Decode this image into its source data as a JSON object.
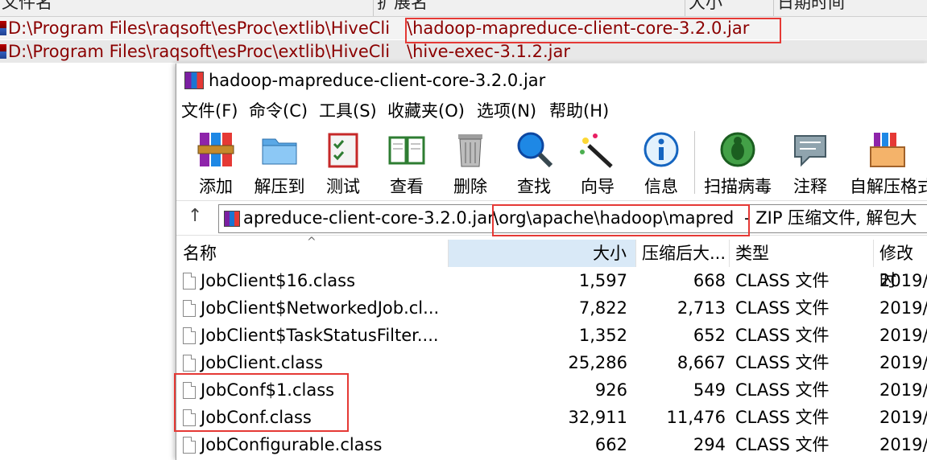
{
  "background_list": {
    "headers": [
      "文件名",
      "扩展名",
      "大小",
      "日期时间"
    ],
    "rows": [
      {
        "path": "D:\\Program Files\\raqsoft\\esProc\\extlib\\HiveCli",
        "ext": "\\hadoop-mapreduce-client-core-3.2.0.jar"
      },
      {
        "path": "D:\\Program Files\\raqsoft\\esProc\\extlib\\HiveCli",
        "ext": "\\hive-exec-3.1.2.jar"
      }
    ]
  },
  "window": {
    "title": "hadoop-mapreduce-client-core-3.2.0.jar",
    "menu": [
      "文件(F)",
      "命令(C)",
      "工具(S)",
      "收藏夹(O)",
      "选项(N)",
      "帮助(H)"
    ],
    "toolbar": [
      "添加",
      "解压到",
      "测试",
      "查看",
      "删除",
      "查找",
      "向导",
      "信息",
      "扫描病毒",
      "注释",
      "自解压格式"
    ],
    "address": {
      "part1": "apreduce-client-core-3.2.0.jar",
      "part2": "\\org\\apache\\hadoop\\mapred",
      "part3": "- ZIP 压缩文件, 解包大"
    },
    "columns": {
      "name": "名称",
      "size": "大小",
      "packed": "压缩后大...",
      "type": "类型",
      "modified": "修改时"
    },
    "files": [
      {
        "name": "JobClient$16.class",
        "size": "1,597",
        "packed": "668",
        "type": "CLASS 文件",
        "modified": "2019/"
      },
      {
        "name": "JobClient$NetworkedJob.cl...",
        "size": "7,822",
        "packed": "2,713",
        "type": "CLASS 文件",
        "modified": "2019/"
      },
      {
        "name": "JobClient$TaskStatusFilter....",
        "size": "1,352",
        "packed": "652",
        "type": "CLASS 文件",
        "modified": "2019/"
      },
      {
        "name": "JobClient.class",
        "size": "25,286",
        "packed": "8,667",
        "type": "CLASS 文件",
        "modified": "2019/"
      },
      {
        "name": "JobConf$1.class",
        "size": "926",
        "packed": "549",
        "type": "CLASS 文件",
        "modified": "2019/"
      },
      {
        "name": "JobConf.class",
        "size": "32,911",
        "packed": "11,476",
        "type": "CLASS 文件",
        "modified": "2019/"
      },
      {
        "name": "JobConfigurable.class",
        "size": "662",
        "packed": "294",
        "type": "CLASS 文件",
        "modified": "2019/"
      }
    ]
  },
  "colors": {
    "highlight": "#e53935",
    "path_text": "#8b0000",
    "sort_header": "#d9e9f7"
  }
}
